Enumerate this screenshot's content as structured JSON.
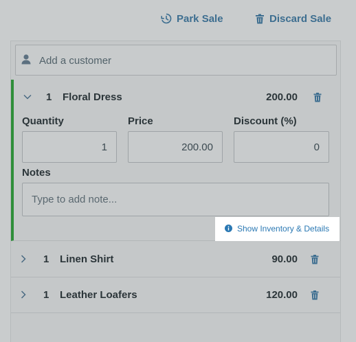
{
  "header": {
    "park_sale_label": "Park Sale",
    "discard_sale_label": "Discard Sale"
  },
  "customer": {
    "placeholder": "Add a customer"
  },
  "line_items": [
    {
      "qty": "1",
      "name": "Floral Dress",
      "price": "200.00",
      "expanded": true,
      "fields": {
        "quantity_label": "Quantity",
        "quantity_value": "1",
        "price_label": "Price",
        "price_value": "200.00",
        "discount_label": "Discount (%)",
        "discount_value": "0",
        "notes_label": "Notes",
        "notes_placeholder": "Type to add note..."
      },
      "show_inventory_label": "Show Inventory & Details"
    },
    {
      "qty": "1",
      "name": "Linen Shirt",
      "price": "90.00",
      "expanded": false
    },
    {
      "qty": "1",
      "name": "Leather Loafers",
      "price": "120.00",
      "expanded": false
    }
  ],
  "colors": {
    "accent_link": "#3d6e90",
    "expanded_indicator": "#2f8e3a",
    "info_link": "#2a78b3"
  },
  "icons": {
    "park": "history-icon",
    "discard": "trash-icon",
    "customer": "user-icon",
    "expand": "chevron-down-icon",
    "collapsed": "chevron-right-icon",
    "delete": "trash-icon",
    "info": "info-icon"
  }
}
